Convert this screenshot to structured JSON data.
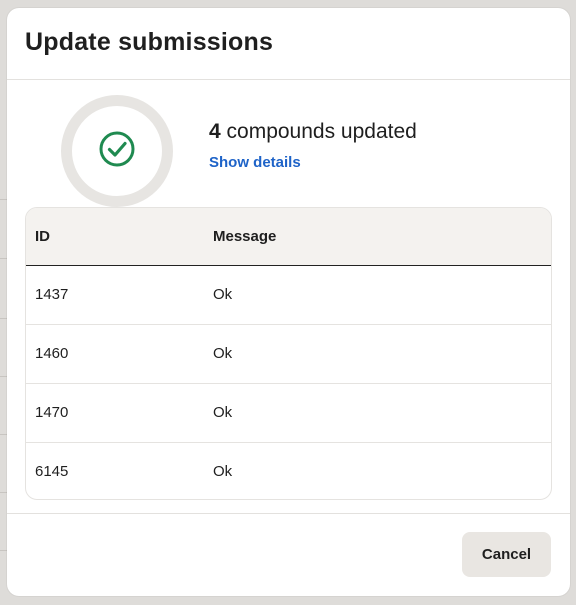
{
  "dialog": {
    "title": "Update submissions"
  },
  "summary": {
    "count": "4",
    "text": "compounds updated",
    "details_link": "Show details",
    "status_icon": "check-circle-icon",
    "status_color": "#1f8a50"
  },
  "table": {
    "columns": [
      "ID",
      "Message"
    ],
    "rows": [
      {
        "id": "1437",
        "message": "Ok"
      },
      {
        "id": "1460",
        "message": "Ok"
      },
      {
        "id": "1470",
        "message": "Ok"
      },
      {
        "id": "6145",
        "message": "Ok"
      }
    ]
  },
  "footer": {
    "cancel_label": "Cancel"
  },
  "colors": {
    "link": "#1e63c8",
    "header_bg": "#f4f2ef",
    "button_bg": "#e9e6e2"
  }
}
